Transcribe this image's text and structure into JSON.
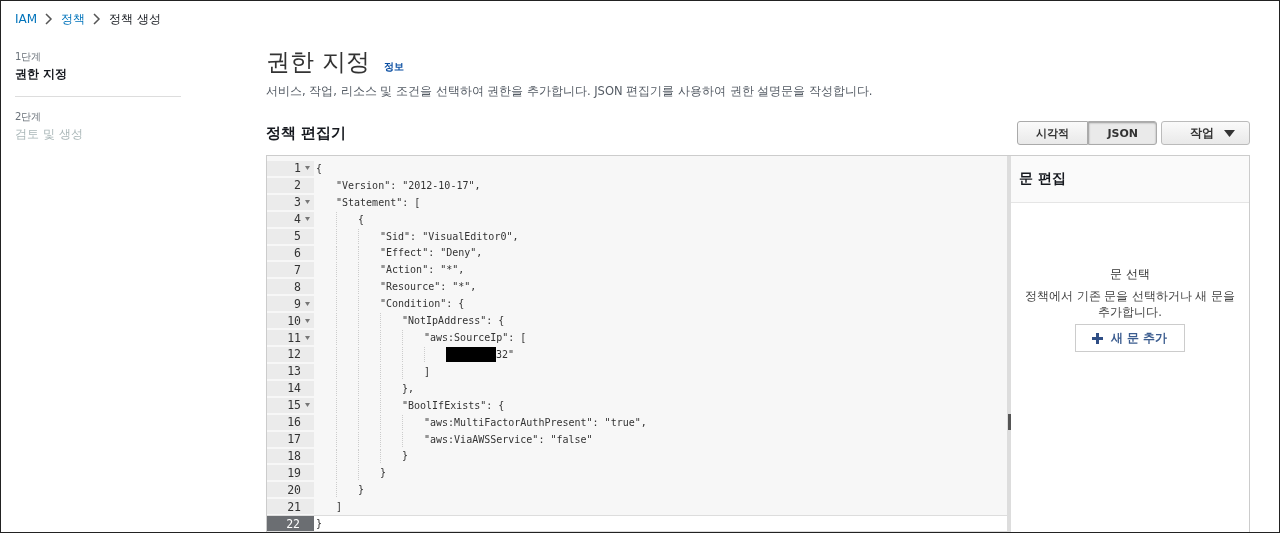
{
  "breadcrumb": [
    {
      "label": "IAM",
      "link": true
    },
    {
      "label": "정책",
      "link": true
    },
    {
      "label": "정책 생성",
      "link": false
    }
  ],
  "steps": [
    {
      "step": "1단계",
      "label": "권한 지정",
      "selected": true
    },
    {
      "step": "2단계",
      "label": "검토 및 생성",
      "selected": false
    }
  ],
  "header": {
    "title": "권한 지정",
    "info": "정보",
    "description": "서비스, 작업, 리소스 및 조건을 선택하여 권한을 추가합니다. JSON 편집기를 사용하여 권한 설명문을 작성합니다."
  },
  "editor": {
    "title": "정책 편집기",
    "mode_tabs": [
      {
        "label": "시각적",
        "selected": false
      },
      {
        "label": "JSON",
        "selected": true
      }
    ],
    "actions_button": "작업",
    "lines": [
      {
        "number": "1",
        "text": "{",
        "current": false,
        "children": [
          {
            "number": "2",
            "text": "\"Version\": \"2012-10-17\",",
            "current": false
          },
          {
            "number": "3",
            "text": "\"Statement\": [",
            "current": false,
            "children": [
              {
                "number": "4",
                "text": "{",
                "current": false,
                "children": [
                  {
                    "number": "5",
                    "text": "\"Sid\": \"VisualEditor0\",",
                    "current": false
                  },
                  {
                    "number": "6",
                    "text": "\"Effect\": \"Deny\",",
                    "current": false
                  },
                  {
                    "number": "7",
                    "text": "\"Action\": \"*\",",
                    "current": false
                  },
                  {
                    "number": "8",
                    "text": "\"Resource\": \"*\",",
                    "current": false
                  },
                  {
                    "number": "9",
                    "text": "\"Condition\": {",
                    "current": false,
                    "children": [
                      {
                        "number": "10",
                        "text": "\"NotIpAddress\": {",
                        "current": false,
                        "children": [
                          {
                            "number": "11",
                            "text": "\"aws:SourceIp\": [",
                            "current": false,
                            "children": [
                              {
                                "number": "12",
                                "text": "32\"",
                                "redacted": true,
                                "current": false
                              }
                            ]
                          },
                          {
                            "number": "13",
                            "text": "]",
                            "current": false
                          }
                        ]
                      },
                      {
                        "number": "14",
                        "text": "},",
                        "current": false
                      },
                      {
                        "number": "15",
                        "text": "\"BoolIfExists\": {",
                        "current": false,
                        "children": [
                          {
                            "number": "16",
                            "text": "\"aws:MultiFactorAuthPresent\": \"true\",",
                            "current": false
                          },
                          {
                            "number": "17",
                            "text": "\"aws:ViaAWSService\": \"false\"",
                            "current": false
                          }
                        ]
                      },
                      {
                        "number": "18",
                        "text": "}",
                        "current": false
                      }
                    ]
                  },
                  {
                    "number": "19",
                    "text": "}",
                    "current": false
                  }
                ]
              },
              {
                "number": "20",
                "text": "}",
                "current": false
              }
            ]
          },
          {
            "number": "21",
            "text": "]",
            "current": false
          }
        ]
      },
      {
        "number": "22",
        "text": "}",
        "current": true
      }
    ]
  },
  "statement_panel": {
    "title": "문 편집",
    "empty_title": "문 선택",
    "empty_text": "정책에서 기존 문을 선택하거나 새 문을 추가합니다.",
    "add_button": "새 문 추가"
  }
}
